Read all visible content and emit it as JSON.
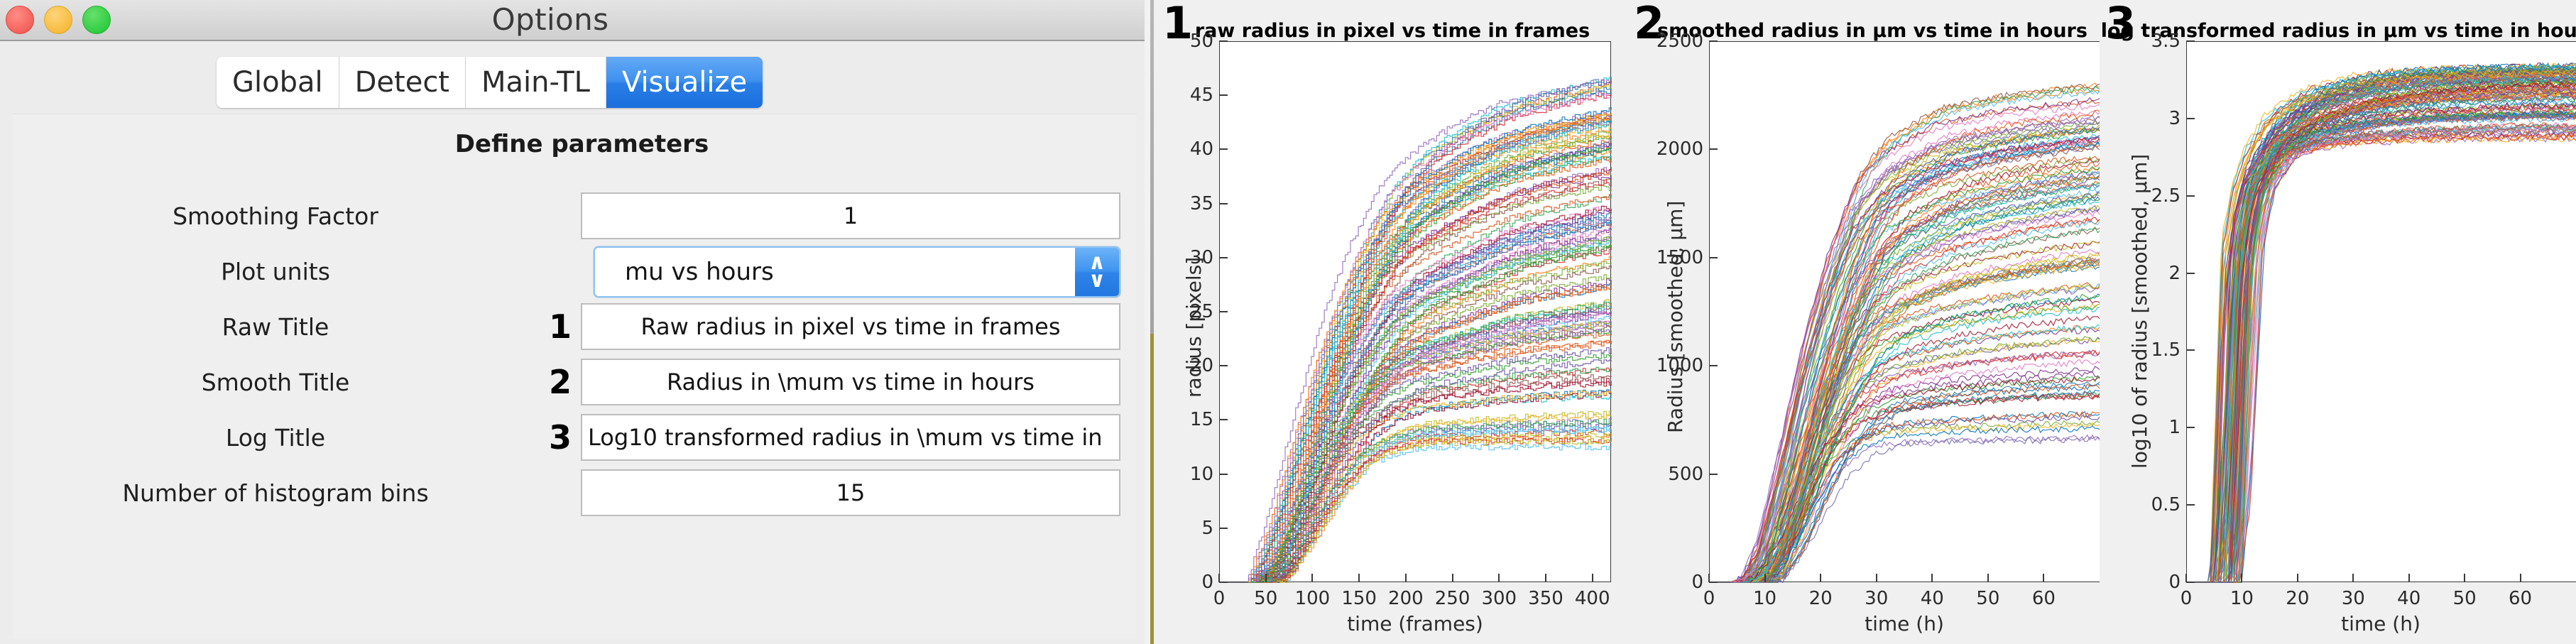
{
  "window": {
    "title": "Options",
    "traffic_lights": [
      "close",
      "minimize",
      "maximize"
    ]
  },
  "tabs": [
    {
      "label": "Global",
      "active": false
    },
    {
      "label": "Detect",
      "active": false
    },
    {
      "label": "Main-TL",
      "active": false
    },
    {
      "label": "Visualize",
      "active": true
    }
  ],
  "panel": {
    "heading": "Define parameters",
    "rows": [
      {
        "label": "Smoothing Factor",
        "marker": "",
        "value": "1",
        "type": "text"
      },
      {
        "label": "Plot units",
        "marker": "",
        "value": "mu vs hours",
        "type": "popup"
      },
      {
        "label": "Raw Title",
        "marker": "1",
        "value": "Raw radius in pixel vs time in frames",
        "type": "text"
      },
      {
        "label": "Smooth Title",
        "marker": "2",
        "value": "Radius in \\mum vs time in hours",
        "type": "text"
      },
      {
        "label": "Log Title",
        "marker": "3",
        "value": "Log10 transformed radius in \\mum vs time in",
        "type": "text-left"
      },
      {
        "label": "Number of histogram bins",
        "marker": "",
        "value": "15",
        "type": "text"
      }
    ],
    "popup_selected": "mu vs hours",
    "popup_arrow_up": "∧",
    "popup_arrow_down": "∨"
  },
  "colors": {
    "accent_blue": "#3d90ef",
    "window_bg": "#ececec",
    "panel_bg": "#efefef",
    "field_bg": "#ffffff",
    "divider_olive": "#9a9434",
    "axis_ink": "#3a3a3a"
  },
  "chart_data": [
    {
      "id": "1",
      "type": "line",
      "title": "raw radius in pixel vs time in frames",
      "xlabel": "time (frames)",
      "ylabel": "radius [pixels]",
      "xlim": [
        0,
        420
      ],
      "ylim": [
        0,
        50
      ],
      "xticks": [
        0,
        50,
        100,
        150,
        200,
        250,
        300,
        350,
        400
      ],
      "xticklabels": [
        "0",
        "50",
        "100",
        "150",
        "200",
        "250",
        "300",
        "350",
        "400"
      ],
      "yticks": [
        0,
        5,
        10,
        15,
        20,
        25,
        30,
        35,
        40,
        45,
        50
      ],
      "yticklabels": [
        "0",
        "5",
        "10",
        "15",
        "20",
        "25",
        "30",
        "35",
        "40",
        "45",
        "50"
      ],
      "grid": false,
      "legend": "none",
      "series_count": 120,
      "description": "Dense bundle of step-wise growth curves; each trace starts at 0, lifts off between frames 28-60, rises steeply to frame ~200 then plateaus. Plateau band spans radius 12 to 47 pixels.",
      "envelope": {
        "x": [
          0,
          30,
          50,
          80,
          110,
          140,
          170,
          200,
          250,
          300,
          350,
          400
        ],
        "upper": [
          0,
          0.5,
          6,
          16,
          25,
          32,
          37,
          40,
          43,
          45,
          46,
          47
        ],
        "median": [
          0,
          0,
          2,
          9,
          16,
          21,
          25,
          27,
          29,
          31,
          32,
          33
        ],
        "lower": [
          0,
          0,
          0.3,
          4,
          8,
          11,
          12,
          12.5,
          12.5,
          12.5,
          12.5,
          12.5
        ]
      }
    },
    {
      "id": "2",
      "type": "line",
      "title": "smoothed radius in μm vs time in hours",
      "xlabel": "time (h)",
      "ylabel": "Radius [smoothed, μm]",
      "xlim": [
        0,
        70
      ],
      "ylim": [
        0,
        2500
      ],
      "xticks": [
        0,
        10,
        20,
        30,
        40,
        50,
        60
      ],
      "xticklabels": [
        "0",
        "10",
        "20",
        "30",
        "40",
        "50",
        "60"
      ],
      "yticks": [
        0,
        500,
        1000,
        1500,
        2000,
        2500
      ],
      "yticklabels": [
        "0",
        "500",
        "1000",
        "1500",
        "2000",
        "2500"
      ],
      "grid": false,
      "legend": "none",
      "series_count": 120,
      "description": "Same traces rescaled to microns and hours; lift-off at 4-10 h, steep rise to ~30 h, then sigmoid plateau. Plateau band spans 600 to 2300 microns.",
      "envelope": {
        "x": [
          0,
          5,
          8,
          12,
          16,
          20,
          25,
          30,
          40,
          50,
          60,
          68
        ],
        "upper": [
          0,
          20,
          220,
          700,
          1180,
          1560,
          1900,
          2060,
          2200,
          2250,
          2280,
          2300
        ],
        "median": [
          0,
          0,
          60,
          360,
          720,
          1010,
          1300,
          1450,
          1580,
          1650,
          1700,
          1730
        ],
        "lower": [
          0,
          0,
          10,
          140,
          330,
          500,
          600,
          640,
          650,
          655,
          660,
          660
        ]
      }
    },
    {
      "id": "3",
      "type": "line",
      "title": "log transformed radius in μm vs time in hours",
      "xlabel": "time (h)",
      "ylabel": "log10 of radius [smoothed, μm]",
      "xlim": [
        0,
        70
      ],
      "ylim": [
        0,
        3.5
      ],
      "xticks": [
        0,
        10,
        20,
        30,
        40,
        50,
        60
      ],
      "xticklabels": [
        "0",
        "10",
        "20",
        "30",
        "40",
        "50",
        "60"
      ],
      "yticks": [
        0,
        0.5,
        1,
        1.5,
        2,
        2.5,
        3,
        3.5
      ],
      "yticklabels": [
        "0",
        "0.5",
        "1",
        "1.5",
        "2",
        "2.5",
        "3",
        "3.5"
      ],
      "grid": false,
      "legend": "none",
      "series_count": 120,
      "description": "log10 of the smoothed radii; near-vertical jump from 0 to about 2.2 between 4 and 10 h, then a shallow saturating rise to a band between 2.85 and 3.35.",
      "envelope": {
        "x": [
          0,
          4,
          6,
          8,
          10,
          14,
          20,
          30,
          40,
          50,
          60,
          68
        ],
        "upper": [
          0,
          0.1,
          2.25,
          2.6,
          2.82,
          3.05,
          3.2,
          3.3,
          3.33,
          3.34,
          3.35,
          3.35
        ],
        "median": [
          0,
          0,
          1.9,
          2.4,
          2.62,
          2.85,
          3.0,
          3.12,
          3.18,
          3.2,
          3.22,
          3.22
        ],
        "lower": [
          0,
          0,
          0.0,
          2.0,
          2.5,
          2.72,
          2.8,
          2.84,
          2.85,
          2.86,
          2.86,
          2.86
        ]
      }
    }
  ]
}
